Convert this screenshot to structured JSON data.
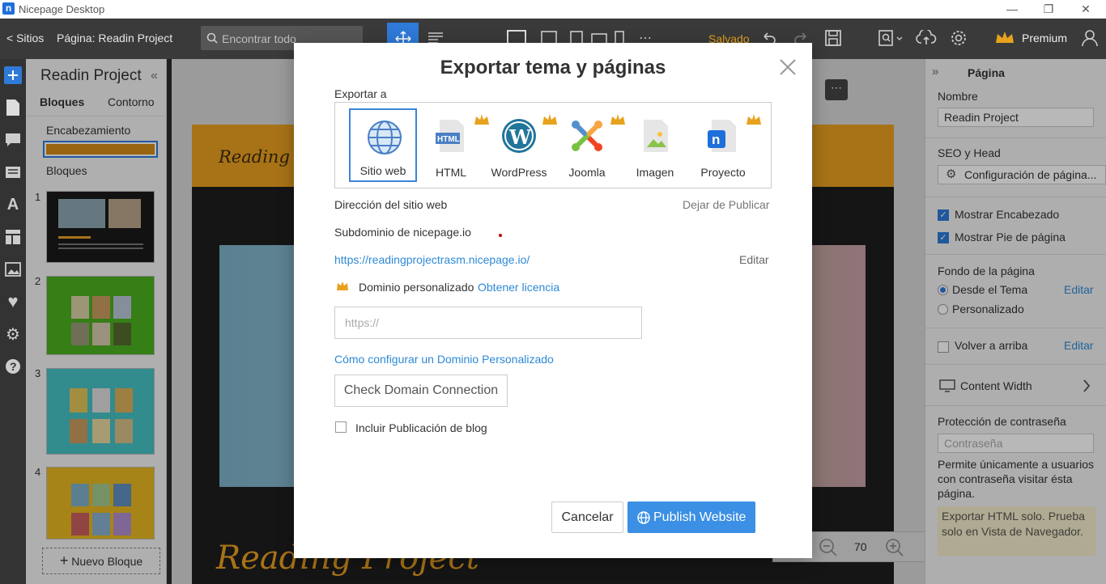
{
  "window": {
    "title": "Nicepage Desktop",
    "app_icon_letter": "n"
  },
  "toolbar": {
    "back_label": "< Sitios",
    "page_label": "Página: Readin Project",
    "search_placeholder": "Encontrar todo",
    "saved_label": "Salvado",
    "premium_label": "Premium"
  },
  "left_panel": {
    "title": "Readin Project",
    "tabs": [
      "Bloques",
      "Contorno"
    ],
    "header_label": "Encabezamiento",
    "blocks_label": "Bloques",
    "thumbnails": [
      {
        "num": "1",
        "bg": "#1a1a1a"
      },
      {
        "num": "2",
        "bg": "#4caf1f"
      },
      {
        "num": "3",
        "bg": "#46c1c4"
      },
      {
        "num": "4",
        "bg": "#e6b820"
      }
    ],
    "new_block_label": "Nuevo Bloque"
  },
  "canvas": {
    "header_text": "Reading Proj",
    "big_text": "Reading Project",
    "zoom_value": "70"
  },
  "right_panel": {
    "title": "Página",
    "name_label": "Nombre",
    "name_value": "Readin Project",
    "seo_label": "SEO y Head",
    "seo_button": "Configuración de página...",
    "show_header_label": "Mostrar Encabezado",
    "show_footer_label": "Mostrar Pie de página",
    "background_label": "Fondo de la página",
    "from_theme_label": "Desde el Tema",
    "edit_label": "Editar",
    "custom_label": "Personalizado",
    "back_to_top_label": "Volver a arriba",
    "content_width_label": "Content Width",
    "password_label": "Protección de contraseña",
    "password_placeholder": "Contraseña",
    "password_desc": "Permite únicamente a usuarios con contraseña visitar ésta página.",
    "note_text": "Exportar HTML solo. Prueba solo en Vista de Navegador."
  },
  "modal": {
    "title": "Exportar tema y páginas",
    "export_to_label": "Exportar a",
    "options": [
      {
        "name": "Sitio web",
        "icon": "globe-icon",
        "selected": true,
        "premium": false
      },
      {
        "name": "HTML",
        "icon": "html-file-icon",
        "selected": false,
        "premium": true
      },
      {
        "name": "WordPress",
        "icon": "wordpress-icon",
        "selected": false,
        "premium": true
      },
      {
        "name": "Joomla",
        "icon": "joomla-icon",
        "selected": false,
        "premium": true
      },
      {
        "name": "Imagen",
        "icon": "image-file-icon",
        "selected": false,
        "premium": false
      },
      {
        "name": "Proyecto",
        "icon": "nicepage-file-icon",
        "selected": false,
        "premium": true
      }
    ],
    "site_address_label": "Dirección del sitio web",
    "unpublish_label": "Dejar de Publicar",
    "subdomain_label": "Subdominio de nicepage.io",
    "site_url": "https://readingprojectrasm.nicepage.io/",
    "edit_label": "Editar",
    "custom_domain_label": "Dominio personalizado",
    "get_license_label": "Obtener licencia",
    "domain_placeholder": "https://",
    "how_to_link": "Cómo configurar un Dominio Personalizado",
    "check_domain_label": "Check Domain Connection",
    "include_blog_label": "Incluir Publicación de blog",
    "cancel_label": "Cancelar",
    "publish_label": "Publish Website"
  },
  "colors": {
    "accent": "#3b8fe4",
    "saved": "#e8a21d",
    "crown": "#e8a21d",
    "toolbar_bg": "#3a3a3a"
  }
}
